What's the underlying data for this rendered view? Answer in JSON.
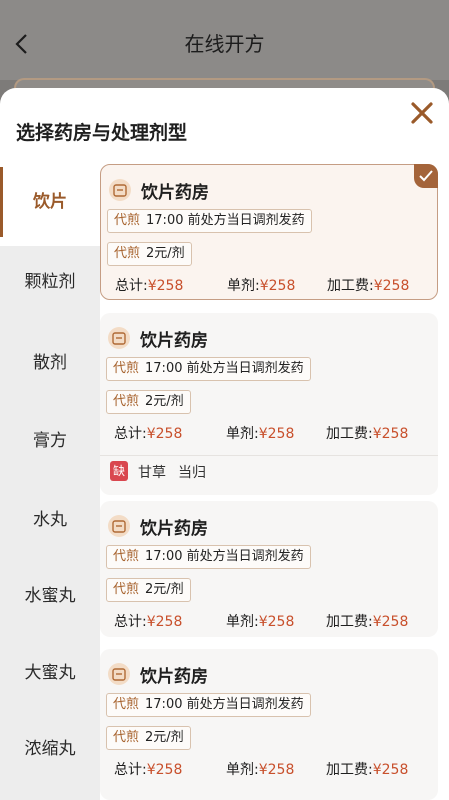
{
  "header": {
    "back_icon": "chevron-left-icon",
    "title": "在线开方"
  },
  "sheet": {
    "title": "选择药房与处理剂型",
    "close_icon": "close-icon"
  },
  "colors": {
    "accent": "#9a5a2a",
    "price": "#c8502c",
    "missing_badge": "#d9474f"
  },
  "sidebar": {
    "items": [
      {
        "label": "饮片",
        "active": true
      },
      {
        "label": "颗粒剂"
      },
      {
        "label": "散剂"
      },
      {
        "label": "膏方"
      },
      {
        "label": "水丸"
      },
      {
        "label": "水蜜丸"
      },
      {
        "label": "大蜜丸"
      },
      {
        "label": "浓缩丸"
      }
    ]
  },
  "cards": [
    {
      "name": "饮片药房",
      "selected": true,
      "tag1_hl": "代煎",
      "tag1_text": "17:00 前处方当日调剂发药",
      "tag2_hl": "代煎",
      "tag2_text": "2元/剂",
      "total_label": "总计:",
      "total": "¥258",
      "single_label": "单剂:",
      "single": "¥258",
      "fee_label": "加工费:",
      "fee": "¥258"
    },
    {
      "name": "饮片药房",
      "tag1_hl": "代煎",
      "tag1_text": "17:00 前处方当日调剂发药",
      "tag2_hl": "代煎",
      "tag2_text": "2元/剂",
      "total_label": "总计:",
      "total": "¥258",
      "single_label": "单剂:",
      "single": "¥258",
      "fee_label": "加工费:",
      "fee": "¥258",
      "missing_badge": "缺",
      "missing_items": [
        "甘草",
        "当归"
      ]
    },
    {
      "name": "饮片药房",
      "tag1_hl": "代煎",
      "tag1_text": "17:00 前处方当日调剂发药",
      "tag2_hl": "代煎",
      "tag2_text": "2元/剂",
      "total_label": "总计:",
      "total": "¥258",
      "single_label": "单剂:",
      "single": "¥258",
      "fee_label": "加工费:",
      "fee": "¥258"
    },
    {
      "name": "饮片药房",
      "tag1_hl": "代煎",
      "tag1_text": "17:00 前处方当日调剂发药",
      "tag2_hl": "代煎",
      "tag2_text": "2元/剂",
      "total_label": "总计:",
      "total": "¥258",
      "single_label": "单剂:",
      "single": "¥258",
      "fee_label": "加工费:",
      "fee": "¥258"
    }
  ]
}
